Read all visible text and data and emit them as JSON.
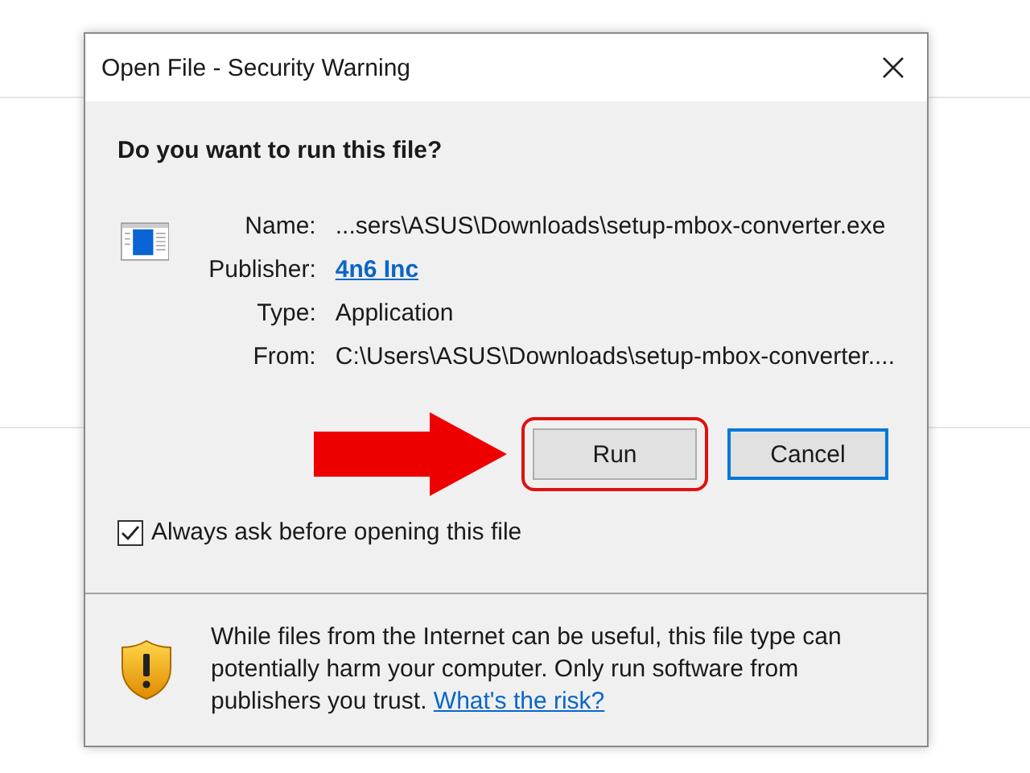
{
  "window": {
    "title": "Open File - Security Warning"
  },
  "heading": "Do you want to run this file?",
  "fields": [
    {
      "label": "Name:",
      "value": "...sers\\ASUS\\Downloads\\setup-mbox-converter.exe",
      "kind": "text"
    },
    {
      "label": "Publisher:",
      "value": "4n6 Inc",
      "kind": "link"
    },
    {
      "label": "Type:",
      "value": "Application",
      "kind": "text"
    },
    {
      "label": "From:",
      "value": "C:\\Users\\ASUS\\Downloads\\setup-mbox-converter....",
      "kind": "text"
    }
  ],
  "buttons": [
    {
      "label": "Run",
      "highlighted": true,
      "focused": false
    },
    {
      "label": "Cancel",
      "highlighted": false,
      "focused": true
    }
  ],
  "checkbox": {
    "label": "Always ask before opening this file",
    "checked": true
  },
  "warning": {
    "text": "While files from the Internet can be useful, this file type can potentially harm your computer. Only run software from publishers you trust.",
    "link": "What's the risk?"
  }
}
